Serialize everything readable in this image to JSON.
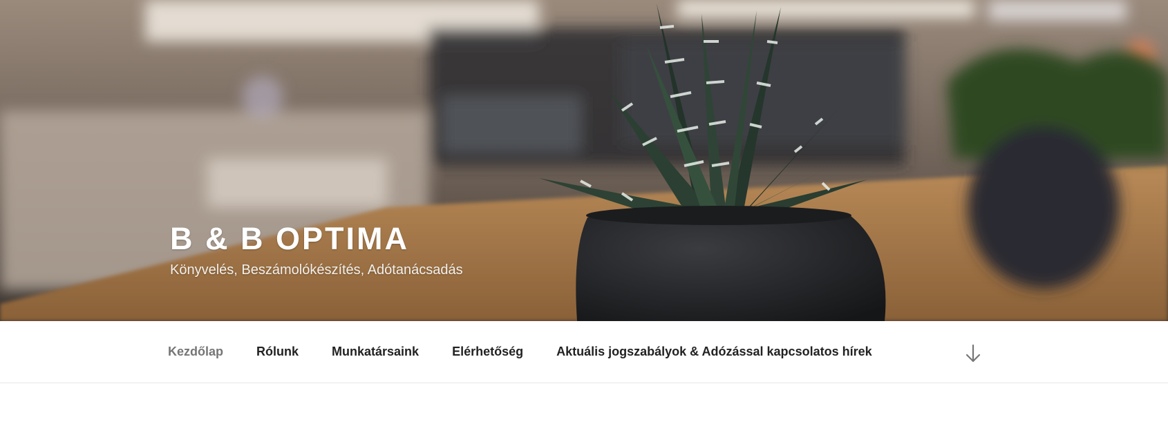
{
  "site": {
    "title": "B & B OPTIMA",
    "description": "Könyvelés, Beszámolókészítés, Adótanácsadás"
  },
  "nav": {
    "items": [
      {
        "label": "Kezdőlap",
        "current": true
      },
      {
        "label": "Rólunk"
      },
      {
        "label": "Munkatársaink"
      },
      {
        "label": "Elérhetőség"
      },
      {
        "label": "Aktuális jogszabályok & Adózással kapcsolatos hírek"
      }
    ],
    "scroll_icon": "arrow-down-icon"
  },
  "colors": {
    "nav_current": "#767676",
    "nav_text": "#222222",
    "title": "#ffffff"
  }
}
